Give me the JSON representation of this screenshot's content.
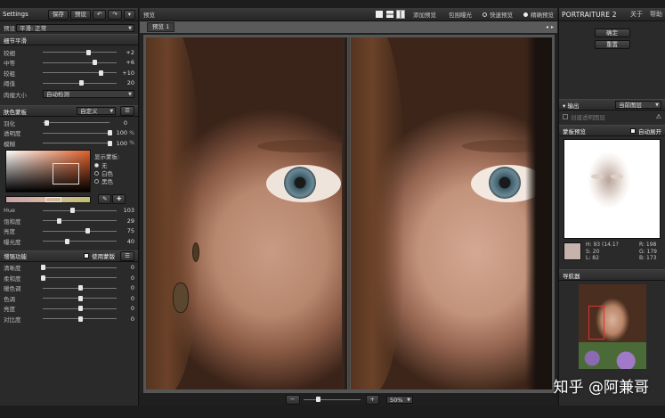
{
  "left": {
    "title": "Settings",
    "toolbar": {
      "save": "保存",
      "preset": "预设"
    },
    "preset_label": "预设",
    "preset_value": "平滑: 正常",
    "detail_section": "细节平滑",
    "detail_rows": [
      {
        "label": "较细",
        "value": "+2",
        "pos": 0.62
      },
      {
        "label": "中等",
        "value": "+6",
        "pos": 0.7
      },
      {
        "label": "较粗",
        "value": "+10",
        "pos": 0.78
      },
      {
        "label": "阈值",
        "value": "20",
        "pos": 0.52
      }
    ],
    "size_label": "肉瘤大小",
    "size_value": "自动检测",
    "skin_section": "肤色蒙板",
    "skin_mode": "自定义",
    "skin_rows": [
      {
        "label": "羽化",
        "value": "0",
        "unit": "",
        "pos": 0.05
      },
      {
        "label": "透明度",
        "value": "100",
        "unit": "%",
        "pos": 1.0
      },
      {
        "label": "模糊",
        "value": "100",
        "unit": "%",
        "pos": 1.0
      }
    ],
    "show_mask": "显示蒙板:",
    "mask_options": [
      "无",
      "白色",
      "黑色"
    ],
    "hsl_rows": [
      {
        "label": "Hue",
        "value": "103",
        "pos": 0.4
      },
      {
        "label": "饱和度",
        "value": "29",
        "pos": 0.22
      },
      {
        "label": "亮度",
        "value": "75",
        "pos": 0.6
      },
      {
        "label": "曝光度",
        "value": "40",
        "pos": 0.33
      }
    ],
    "enhance_section": "增强功能",
    "use_mask": "使用蒙版",
    "enhance_rows": [
      {
        "label": "清晰度",
        "value": "0",
        "pos": 0.0
      },
      {
        "label": "柔和度",
        "value": "0",
        "pos": 0.0
      },
      {
        "label": "暖色调",
        "value": "0",
        "pos": 0.5
      },
      {
        "label": "色调",
        "value": "0",
        "pos": 0.5
      },
      {
        "label": "亮度",
        "value": "0",
        "pos": 0.5
      },
      {
        "label": "对比度",
        "value": "0",
        "pos": 0.5
      }
    ]
  },
  "center": {
    "title": "预览",
    "add_preview": "添加预览",
    "exposure": "包围曝光",
    "fast_preview": "快速预览",
    "precise_preview": "精确预览",
    "tab": "预览 1",
    "zoom": "50%"
  },
  "right": {
    "app_title_a": "PORTRAIT",
    "app_title_b": "URE 2",
    "about": "关于",
    "help": "帮助",
    "ok": "确定",
    "reset": "重置",
    "output_section": "输出",
    "output_value": "当前图层",
    "create_layer": "创建透明图层",
    "mask_preview": "蒙板预览",
    "auto_expand": "自动展开",
    "info": {
      "h": "H: 93 (14.1?",
      "r": "R: 198",
      "s": "S: 20",
      "g": "G: 179",
      "l": "L: 82",
      "b": "B: 173"
    },
    "navigator": "导航器"
  },
  "watermark": "知乎 @阿兼哥",
  "colors": {
    "panel": "#2a2a2a",
    "accent": "#e8e8e8",
    "nav_box": "#e03030"
  }
}
